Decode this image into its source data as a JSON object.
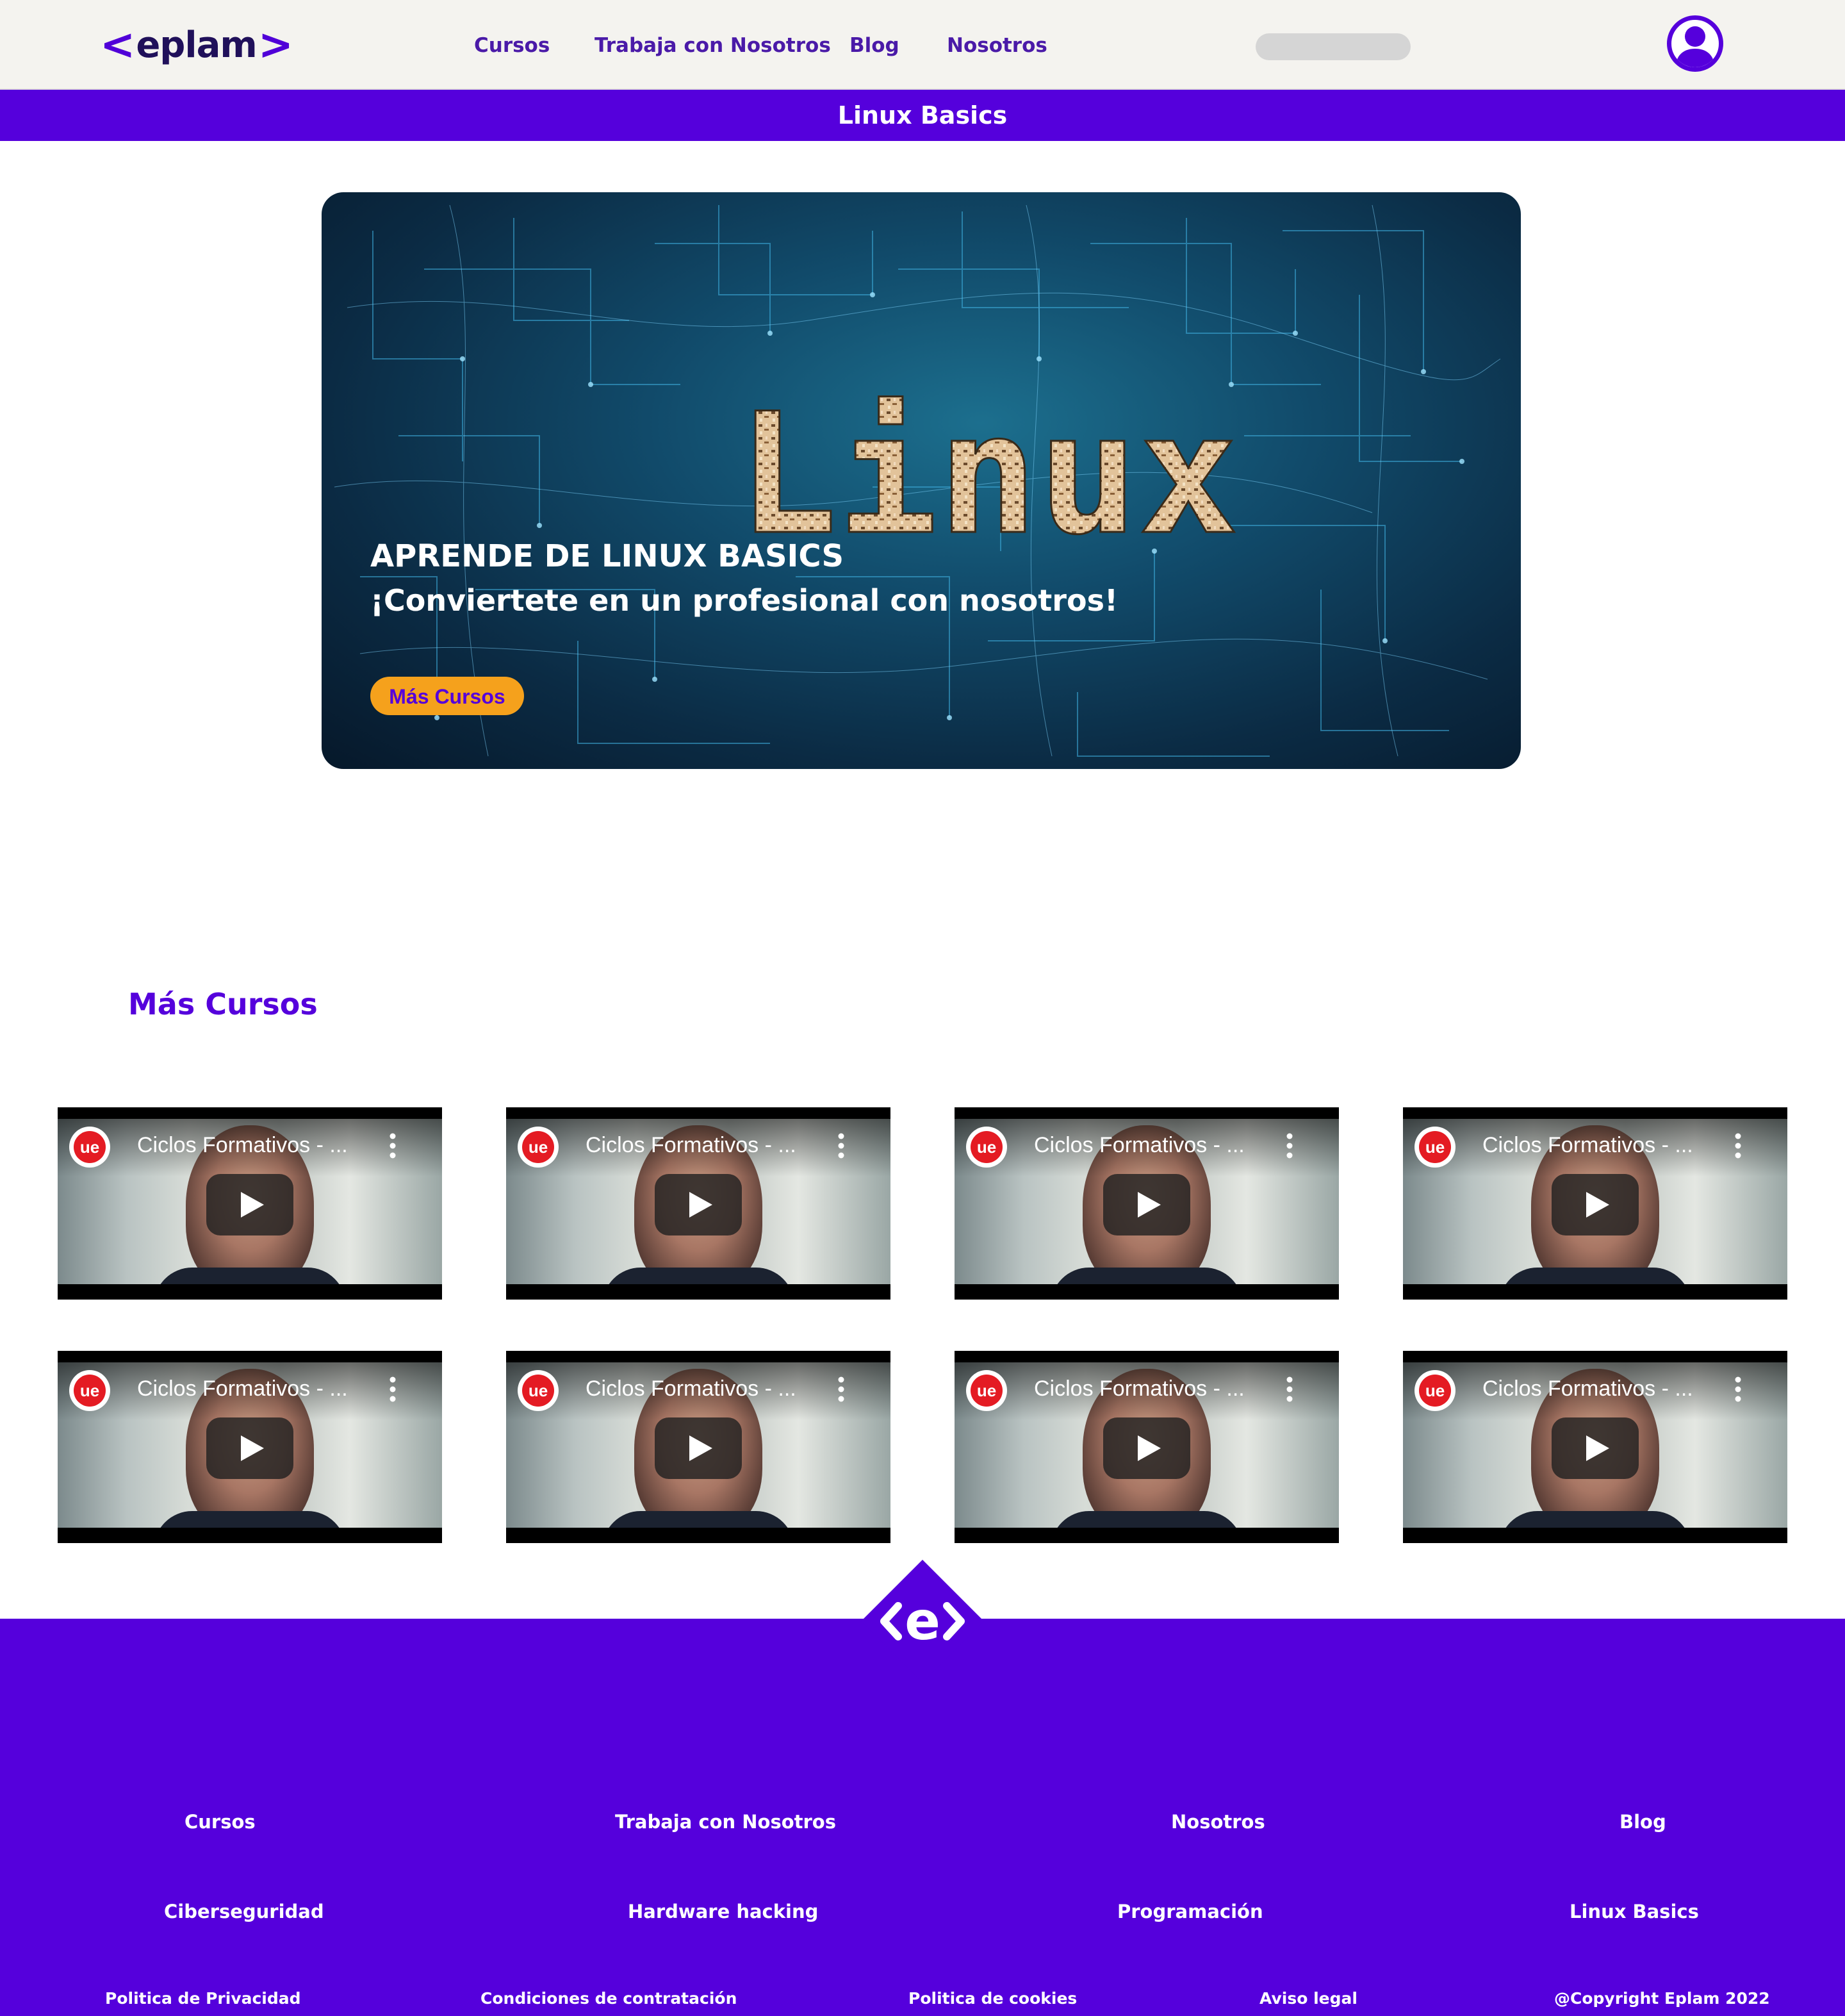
{
  "header": {
    "logo_text": "eplam",
    "nav": [
      "Cursos",
      "Trabaja con Nosotros",
      "Blog",
      "Nosotros"
    ],
    "search_placeholder": ""
  },
  "page_title": "Linux Basics",
  "hero": {
    "art_word": "Linux",
    "heading": "APRENDE DE LINUX BASICS",
    "subheading": "¡Conviertete en un profesional con nosotros!",
    "button_label": "Más Cursos"
  },
  "more_courses": {
    "title": "Más Cursos",
    "videos": [
      {
        "channel_logo": "ue",
        "title": "Ciclos Formativos - ..."
      },
      {
        "channel_logo": "ue",
        "title": "Ciclos Formativos - ..."
      },
      {
        "channel_logo": "ue",
        "title": "Ciclos Formativos - ..."
      },
      {
        "channel_logo": "ue",
        "title": "Ciclos Formativos - ..."
      },
      {
        "channel_logo": "ue",
        "title": "Ciclos Formativos - ..."
      },
      {
        "channel_logo": "ue",
        "title": "Ciclos Formativos - ..."
      },
      {
        "channel_logo": "ue",
        "title": "Ciclos Formativos - ..."
      },
      {
        "channel_logo": "ue",
        "title": "Ciclos Formativos - ..."
      }
    ]
  },
  "footer": {
    "emblem_letter": "e",
    "row1": [
      "Cursos",
      "Trabaja con Nosotros",
      "Nosotros",
      "Blog"
    ],
    "row2": [
      "Ciberseguridad",
      "Hardware hacking",
      "Programación",
      "Linux Basics"
    ],
    "row3": [
      "Politica de Privacidad",
      "Condiciones de contratación",
      "Politica de cookies",
      "Aviso legal",
      "@Copyright Eplam 2022"
    ]
  },
  "colors": {
    "brand_purple": "#5500dc",
    "accent_orange": "#f5a11c",
    "header_bg": "#f4f3ef"
  },
  "icons": [
    "user-avatar-icon",
    "play-icon",
    "kebab-menu-icon",
    "channel-logo-icon",
    "eplam-emblem-icon"
  ]
}
